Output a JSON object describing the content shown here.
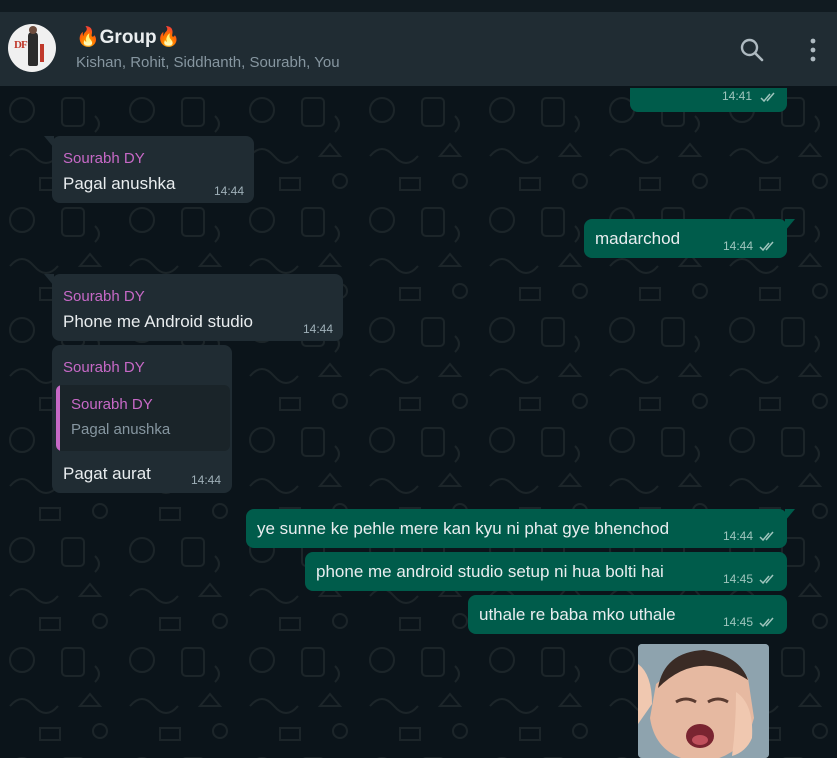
{
  "header": {
    "title": "🔥Group🔥",
    "participants": "Kishan, Rohit, Siddhanth, Sourabh, You",
    "avatar_text": "DF",
    "search_icon": "search-icon",
    "menu_icon": "more-vertical-icon"
  },
  "colors": {
    "background": "#0b141a",
    "header": "#202c33",
    "incoming_bubble": "#202c33",
    "outgoing_bubble": "#005c4b",
    "sender_name": "#c769c7"
  },
  "messages": [
    {
      "direction": "out",
      "text": "",
      "time": "14:41",
      "status": "read"
    },
    {
      "direction": "in",
      "sender": "Sourabh DY",
      "text": "Pagal anushka",
      "time": "14:44"
    },
    {
      "direction": "out",
      "text": "madarchod",
      "time": "14:44",
      "status": "read"
    },
    {
      "direction": "in",
      "sender": "Sourabh DY",
      "text": "Phone me Android studio",
      "time": "14:44"
    },
    {
      "direction": "in",
      "sender": "Sourabh DY",
      "quote": {
        "sender": "Sourabh DY",
        "text": "Pagal anushka"
      },
      "text": "Pagat aurat",
      "time": "14:44"
    },
    {
      "direction": "out",
      "text": "ye sunne ke pehle mere kan kyu ni phat gye bhenchod",
      "time": "14:44",
      "status": "read"
    },
    {
      "direction": "out",
      "text": "phone me android studio setup ni hua bolti hai",
      "time": "14:45",
      "status": "read"
    },
    {
      "direction": "out",
      "text": "uthale re baba mko uthale",
      "time": "14:45",
      "status": "read"
    },
    {
      "direction": "out",
      "type": "sticker",
      "description": "crying-baby-sticker"
    }
  ]
}
